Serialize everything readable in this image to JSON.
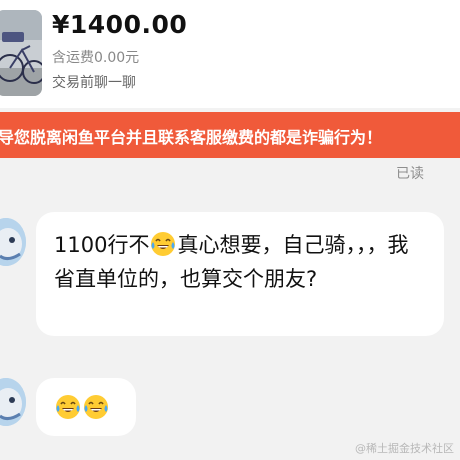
{
  "product": {
    "price": "¥1400.00",
    "shipping": "含运费0.00元",
    "chat_label": "交易前聊一聊"
  },
  "warning": {
    "text": "导您脱离闲鱼平台并且联系客服缴费的都是诈骗行为！"
  },
  "read_status": "已读",
  "messages": [
    {
      "part1": "1100行不",
      "emoji": "tears-of-joy-emoji",
      "part2": "真心想要，自己骑，，，我省直单位的，也算交个朋友?"
    },
    {
      "emojis": [
        "tears-of-joy-emoji",
        "tears-of-joy-emoji"
      ]
    }
  ],
  "watermark": "@稀土掘金技术社区",
  "colors": {
    "warning_bg": "#f05a3a",
    "page_bg": "#f2f2f2",
    "bubble_bg": "#ffffff"
  }
}
